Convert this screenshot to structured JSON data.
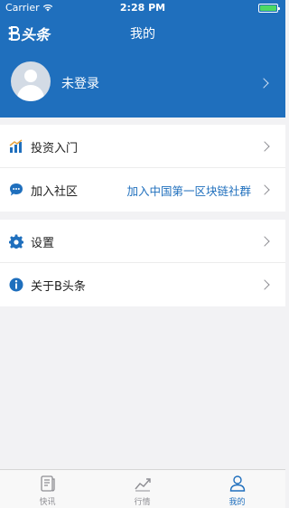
{
  "status_bar": {
    "carrier": "Carrier",
    "time": "2:28 PM",
    "battery_level": 1.0
  },
  "header": {
    "logo_text": "头条",
    "logo_prefix": "B",
    "title": "我的",
    "accent": "#1f6fbd"
  },
  "profile": {
    "login_label": "未登录"
  },
  "menu_group_1": [
    {
      "label": "投资入门",
      "value": "",
      "icon": "chart-bars-icon"
    },
    {
      "label": "加入社区",
      "value": "加入中国第一区块链社群",
      "icon": "chat-bubble-icon"
    }
  ],
  "menu_group_2": [
    {
      "label": "设置",
      "icon": "gear-icon"
    },
    {
      "label": "关于B头条",
      "icon": "info-icon"
    }
  ],
  "tabbar": [
    {
      "label": "快讯",
      "icon": "news-icon",
      "active": false
    },
    {
      "label": "行情",
      "icon": "trend-icon",
      "active": false
    },
    {
      "label": "我的",
      "icon": "user-icon",
      "active": true
    }
  ]
}
